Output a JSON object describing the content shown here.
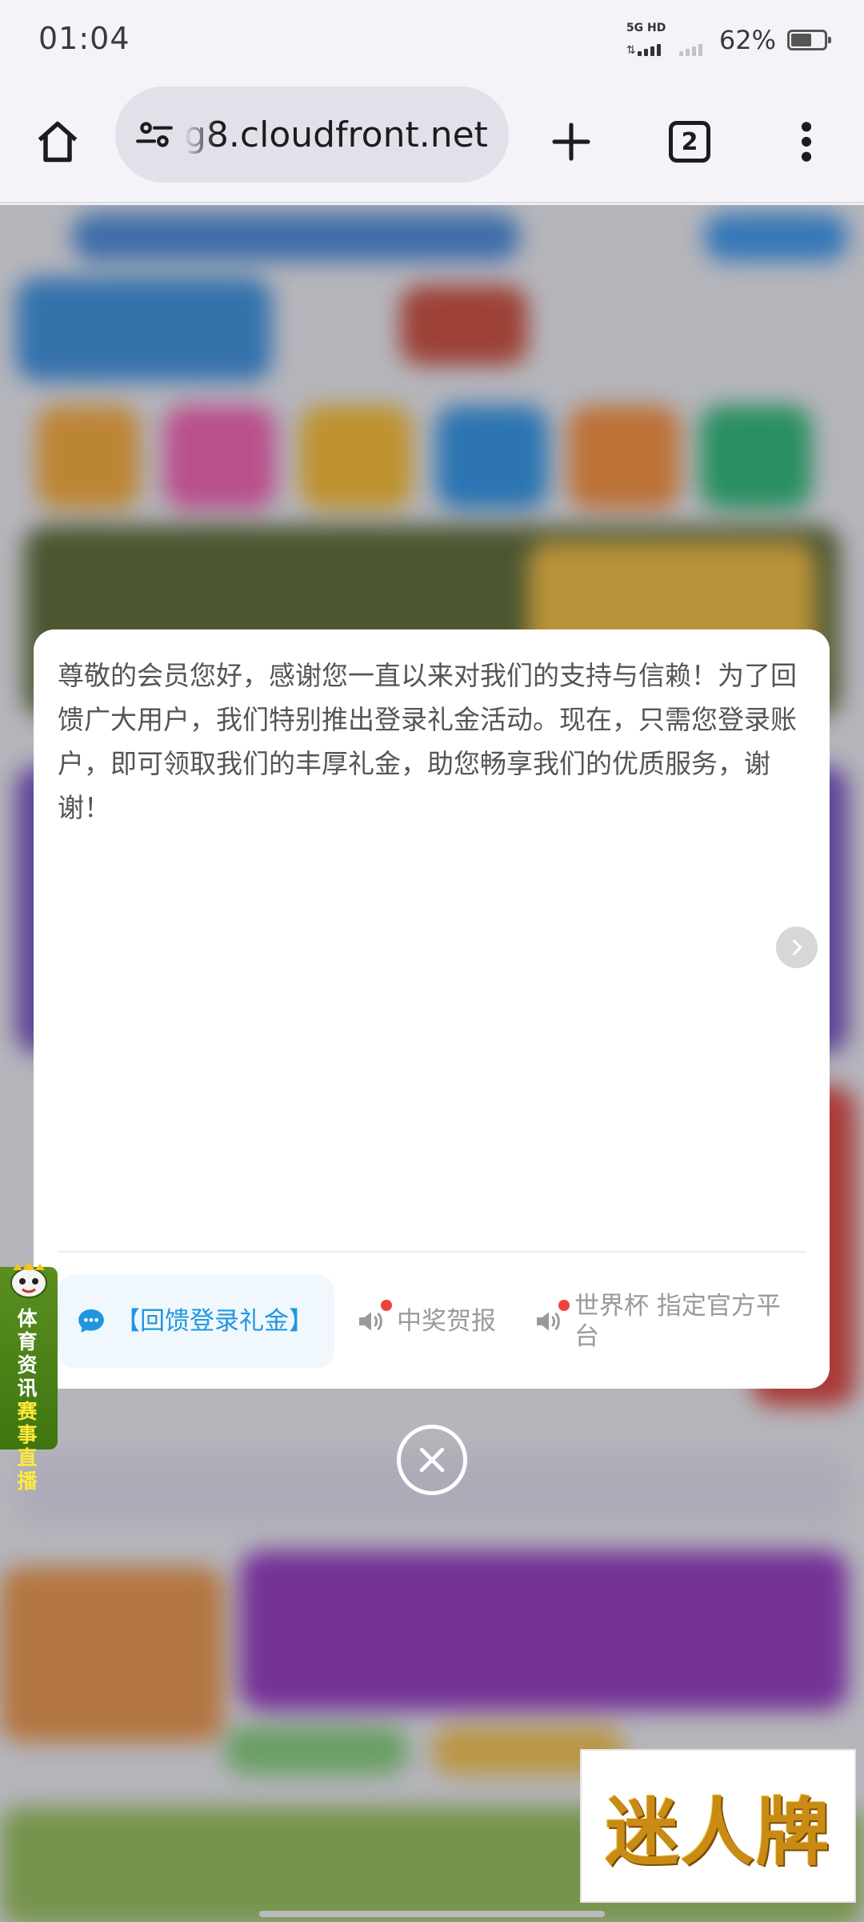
{
  "status_bar": {
    "time": "01:04",
    "network_label": "5G HD",
    "battery_percent": "62%",
    "battery_level": 0.62
  },
  "toolbar": {
    "url": "g8.cloudfront.net",
    "tab_count": "2",
    "icons": [
      "home-icon",
      "site-settings-icon",
      "new-tab-icon",
      "tab-switcher-icon",
      "more-menu-icon"
    ]
  },
  "modal": {
    "message": "尊敬的会员您好，感谢您一直以来对我们的支持与信赖！为了回馈广大用户，我们特别推出登录礼金活动。现在，只需您登录账户，即可领取我们的丰厚礼金，助您畅享我们的优质服务，谢谢！",
    "tabs": [
      {
        "label": "【回馈登录礼金】",
        "icon": "chat-bubble-icon",
        "active": true
      },
      {
        "label": "中奖贺报",
        "icon": "speaker-icon",
        "active": false
      },
      {
        "label": "世界杯 指定官方平台",
        "icon": "speaker-icon",
        "active": false
      }
    ]
  },
  "side_badge": {
    "line1": "体育资讯",
    "line2": "赛事直播"
  },
  "brand_logo": {
    "text": "迷人牌"
  },
  "colors": {
    "accent_blue": "#1f96e0",
    "notification_red": "#f0413a",
    "badge_green": "#4a8418",
    "logo_gold": "#c98b14"
  }
}
